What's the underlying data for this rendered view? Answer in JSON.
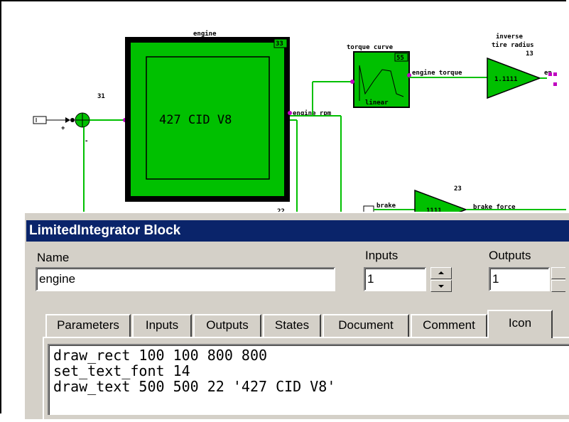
{
  "diagram": {
    "engine_block_label": "engine",
    "engine_block_id": "33",
    "engine_block_text": "427 CID V8",
    "sum_block_id": "31",
    "torque_curve_label": "torque curve",
    "torque_curve_id": "55",
    "torque_curve_caption": "linear",
    "engine_torque_wire": "engine torque",
    "engine_rpm_wire": "engine rpm",
    "inverse_label_line1": "inverse",
    "inverse_label_line2": "tire radius",
    "inverse_id": "13",
    "inverse_value": "1.1111",
    "inverse_out_wire": "en",
    "brake_gain_id": "23",
    "brake_input_label": "brake",
    "brake_gain_value": "1111",
    "brake_force_wire": "brake force",
    "hidden_block_id": "22",
    "plus_sign": "+",
    "minus_sign": "-"
  },
  "dialog": {
    "title": "LimitedIntegrator Block",
    "name_label": "Name",
    "name_value": "engine",
    "inputs_label": "Inputs",
    "inputs_value": "1",
    "outputs_label": "Outputs",
    "outputs_value": "1",
    "tabs": [
      {
        "label": "Parameters"
      },
      {
        "label": "Inputs"
      },
      {
        "label": "Outputs"
      },
      {
        "label": "States"
      },
      {
        "label": "Document"
      },
      {
        "label": "Comment"
      },
      {
        "label": "Icon",
        "active": true
      }
    ],
    "icon_script": [
      "draw_rect 100 100 800 800",
      "set_text_font 14",
      "draw_text 500 500 22 '427 CID V8'"
    ]
  }
}
